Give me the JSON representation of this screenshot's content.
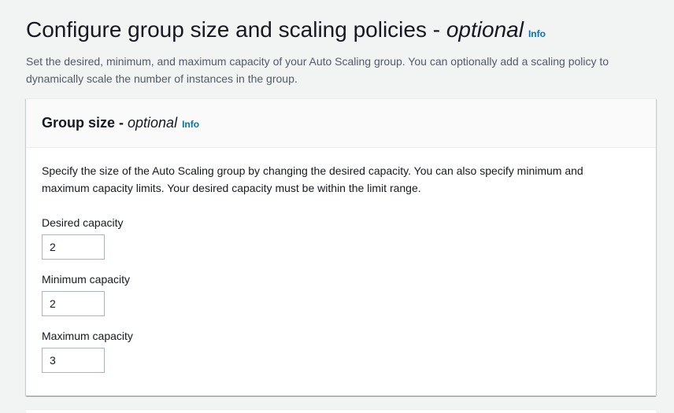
{
  "header": {
    "title_main": "Configure group size and scaling policies - ",
    "title_italic": "optional",
    "info_label": "Info",
    "description": "Set the desired, minimum, and maximum capacity of your Auto Scaling group. You can optionally add a scaling policy to dynamically scale the number of instances in the group."
  },
  "group_size": {
    "title_main": "Group size - ",
    "title_italic": "optional",
    "info_label": "Info",
    "description": "Specify the size of the Auto Scaling group by changing the desired capacity. You can also specify minimum and maximum capacity limits. Your desired capacity must be within the limit range.",
    "fields": [
      {
        "label": "Desired capacity",
        "value": "2"
      },
      {
        "label": "Minimum capacity",
        "value": "2"
      },
      {
        "label": "Maximum capacity",
        "value": "3"
      }
    ]
  },
  "colors": {
    "link": "#0073bb",
    "text": "#16191f",
    "secondary_text": "#545b64",
    "background": "#f2f3f3",
    "input_border": "#aab7b8"
  }
}
